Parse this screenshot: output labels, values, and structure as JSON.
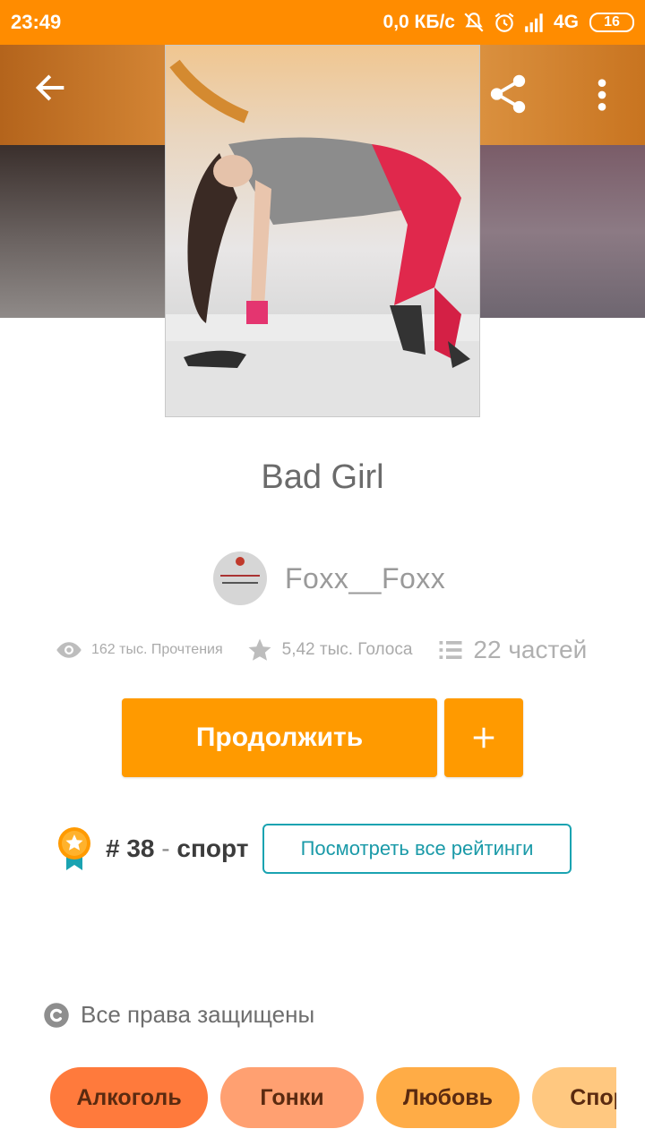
{
  "status_bar": {
    "time": "23:49",
    "speed": "0,0 КБ/с",
    "network": "4G",
    "battery": "16",
    "icons": [
      "mute-icon",
      "alarm-icon",
      "signal-icon"
    ]
  },
  "header": {
    "icons": [
      "back-arrow-icon",
      "share-icon",
      "more-vert-icon"
    ],
    "accent_color": "#ff8c00"
  },
  "story": {
    "title": "Bad Girl",
    "author": "Foxx__Foxx",
    "reads": "162 тыс. Прочтения",
    "votes": "5,42 тыс. Голоса",
    "parts": "22 частей"
  },
  "actions": {
    "continue_label": "Продолжить",
    "add_icon": "plus-icon",
    "button_color": "#ff9a00"
  },
  "ranking": {
    "hash": "#",
    "rank": "38",
    "separator": "-",
    "category": "спорт",
    "view_all_label": "Посмотреть все рейтинги",
    "outline_color": "#1aa3b1"
  },
  "copyright": {
    "label": "Все права защищены"
  },
  "tags": [
    "Алкоголь",
    "Гонки",
    "Любовь",
    "Спорт"
  ]
}
